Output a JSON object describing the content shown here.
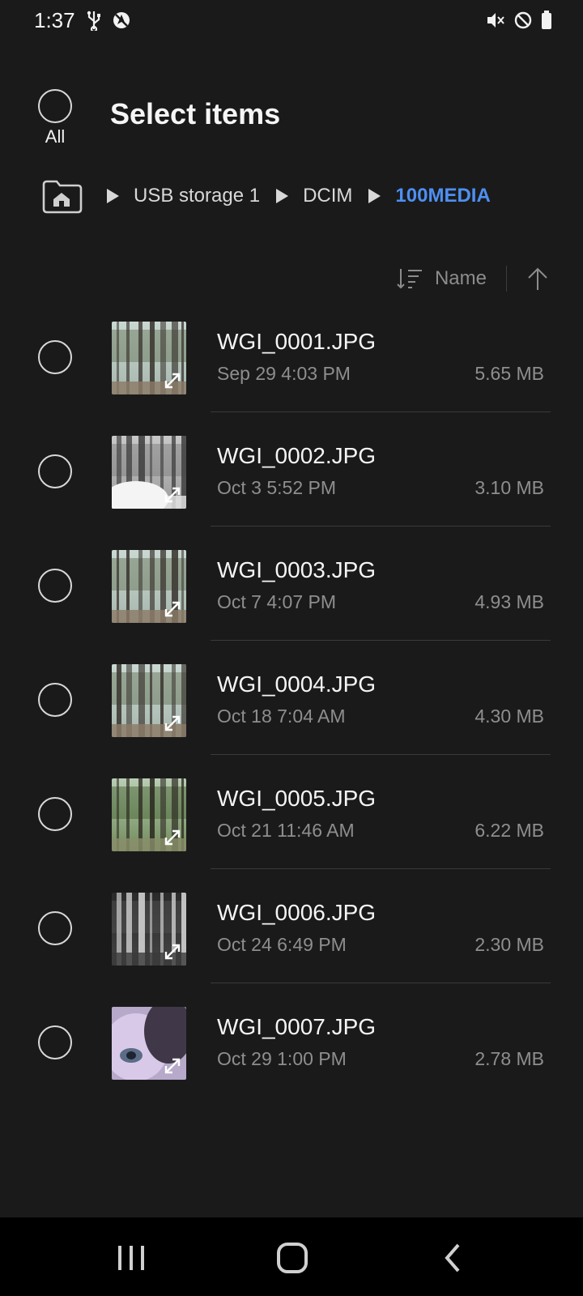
{
  "status_bar": {
    "time": "1:37",
    "left_icons": [
      "usb-icon",
      "no-location-icon"
    ],
    "right_icons": [
      "mute-icon",
      "do-not-disturb-icon",
      "battery-icon"
    ]
  },
  "header": {
    "select_all_label": "All",
    "title": "Select items"
  },
  "breadcrumb": {
    "home_icon": "home-folder-icon",
    "path": [
      "USB storage 1",
      "DCIM",
      "100MEDIA"
    ],
    "current_color": "#4e8ff2"
  },
  "sort": {
    "label": "Name",
    "direction": "ascending"
  },
  "files": [
    {
      "name": "WGI_0001.JPG",
      "date": "Sep 29 4:03 PM",
      "size": "5.65 MB",
      "thumb": "forest-day"
    },
    {
      "name": "WGI_0002.JPG",
      "date": "Oct 3 5:52 PM",
      "size": "3.10 MB",
      "thumb": "forest-gray"
    },
    {
      "name": "WGI_0003.JPG",
      "date": "Oct 7 4:07 PM",
      "size": "4.93 MB",
      "thumb": "forest-day"
    },
    {
      "name": "WGI_0004.JPG",
      "date": "Oct 18 7:04 AM",
      "size": "4.30 MB",
      "thumb": "forest-day"
    },
    {
      "name": "WGI_0005.JPG",
      "date": "Oct 21 11:46 AM",
      "size": "6.22 MB",
      "thumb": "forest-green"
    },
    {
      "name": "WGI_0006.JPG",
      "date": "Oct 24 6:49 PM",
      "size": "2.30 MB",
      "thumb": "forest-night"
    },
    {
      "name": "WGI_0007.JPG",
      "date": "Oct 29 1:00 PM",
      "size": "2.78 MB",
      "thumb": "closeup"
    }
  ],
  "nav_bar": {
    "buttons": [
      "recent-apps-icon",
      "home-icon",
      "back-icon"
    ]
  }
}
